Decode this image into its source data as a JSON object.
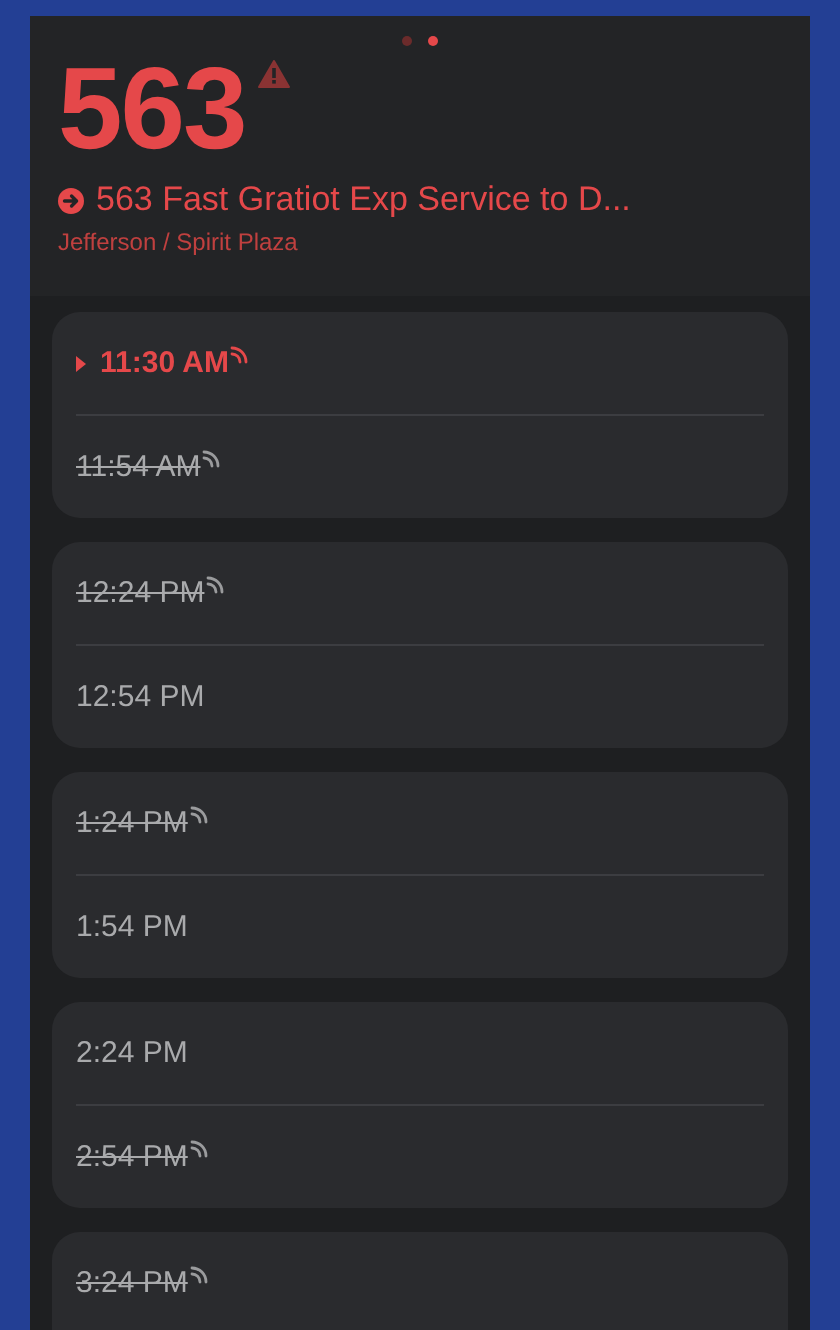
{
  "pager": [
    {
      "selected": false
    },
    {
      "selected": true
    }
  ],
  "route": {
    "number": "563",
    "alert": true,
    "title": "563 Fast Gratiot Exp Service to D...",
    "stop": "Jefferson / Spirit Plaza"
  },
  "trips": [
    {
      "times": [
        {
          "time": "11:30 AM",
          "current": true,
          "struck": false,
          "realtime": true
        },
        {
          "time": "11:54 AM",
          "current": false,
          "struck": true,
          "realtime": true
        }
      ]
    },
    {
      "times": [
        {
          "time": "12:24 PM",
          "current": false,
          "struck": true,
          "realtime": true
        },
        {
          "time": "12:54 PM",
          "current": false,
          "struck": false,
          "realtime": false
        }
      ]
    },
    {
      "times": [
        {
          "time": "1:24 PM",
          "current": false,
          "struck": true,
          "realtime": true
        },
        {
          "time": "1:54 PM",
          "current": false,
          "struck": false,
          "realtime": false
        }
      ]
    },
    {
      "times": [
        {
          "time": "2:24 PM",
          "current": false,
          "struck": false,
          "realtime": false
        },
        {
          "time": "2:54 PM",
          "current": false,
          "struck": true,
          "realtime": true
        }
      ]
    },
    {
      "times": [
        {
          "time": "3:24 PM",
          "current": false,
          "struck": true,
          "realtime": true
        }
      ]
    }
  ]
}
